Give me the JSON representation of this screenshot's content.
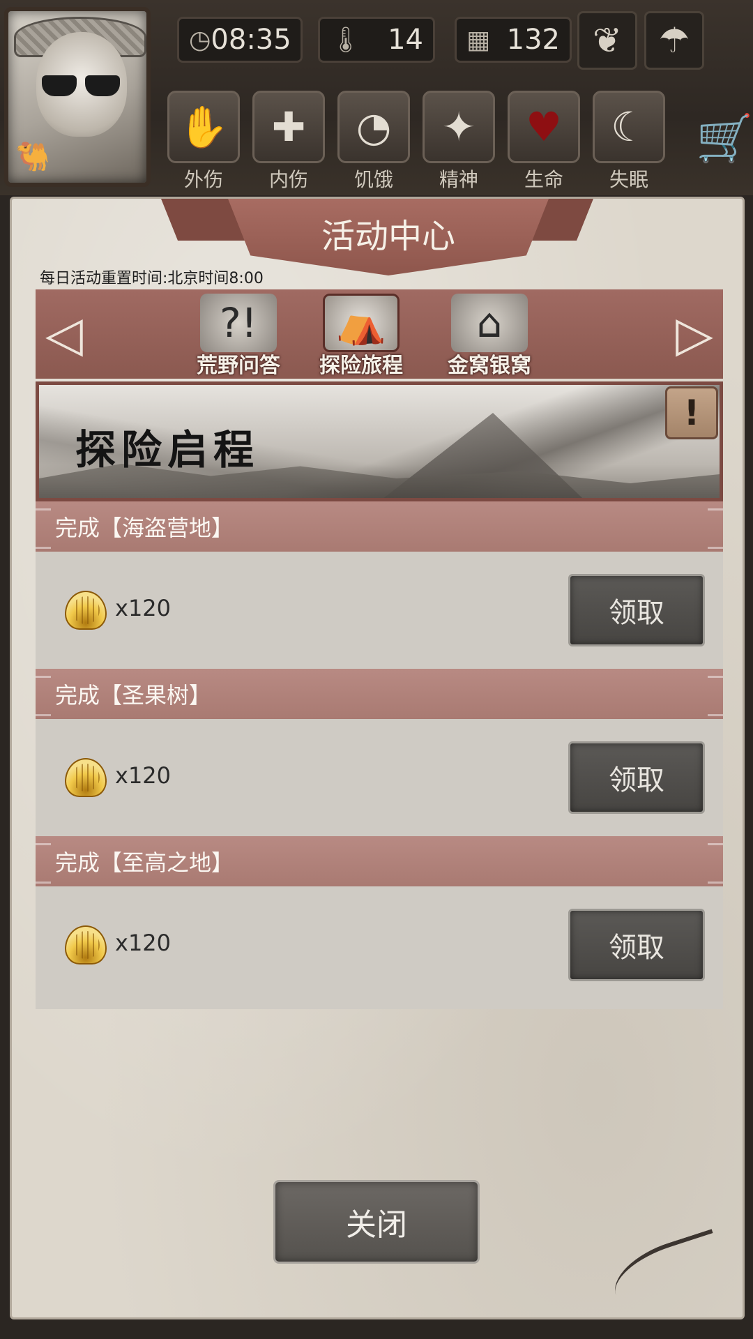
{
  "hud": {
    "time": "08:35",
    "temperature": "14",
    "day": "132",
    "icons": {
      "clock": "clock-icon",
      "thermometer": "thermometer-icon",
      "calendar": "calendar-icon",
      "season": "leaf-icon",
      "weather": "rain-cloud-icon",
      "shop": "cart-icon"
    },
    "status": [
      {
        "label": "外伤",
        "icon": "hand-icon"
      },
      {
        "label": "内伤",
        "icon": "cross-icon"
      },
      {
        "label": "饥饿",
        "icon": "stomach-icon"
      },
      {
        "label": "精神",
        "icon": "mind-icon"
      },
      {
        "label": "生命",
        "icon": "heart-icon"
      },
      {
        "label": "失眠",
        "icon": "moon-icon"
      }
    ]
  },
  "dialog": {
    "title": "活动中心",
    "reset_note": "每日活动重置时间:北京时间8:00",
    "tabs": [
      {
        "label": "荒野问答",
        "icon": "question-icon"
      },
      {
        "label": "探险旅程",
        "icon": "expedition-icon",
        "active": true
      },
      {
        "label": "金窝银窝",
        "icon": "hut-icon"
      }
    ],
    "banner_title": "探险启程",
    "tasks": [
      {
        "title": "完成【海盗营地】",
        "reward_qty": "x120",
        "button": "领取"
      },
      {
        "title": "完成【圣果树】",
        "reward_qty": "x120",
        "button": "领取"
      },
      {
        "title": "完成【至高之地】",
        "reward_qty": "x120",
        "button": "领取"
      }
    ],
    "close_label": "关闭"
  },
  "colors": {
    "accent_red": "#a06a62",
    "parchment": "#ddd7cc",
    "button_dark": "#55524e"
  }
}
